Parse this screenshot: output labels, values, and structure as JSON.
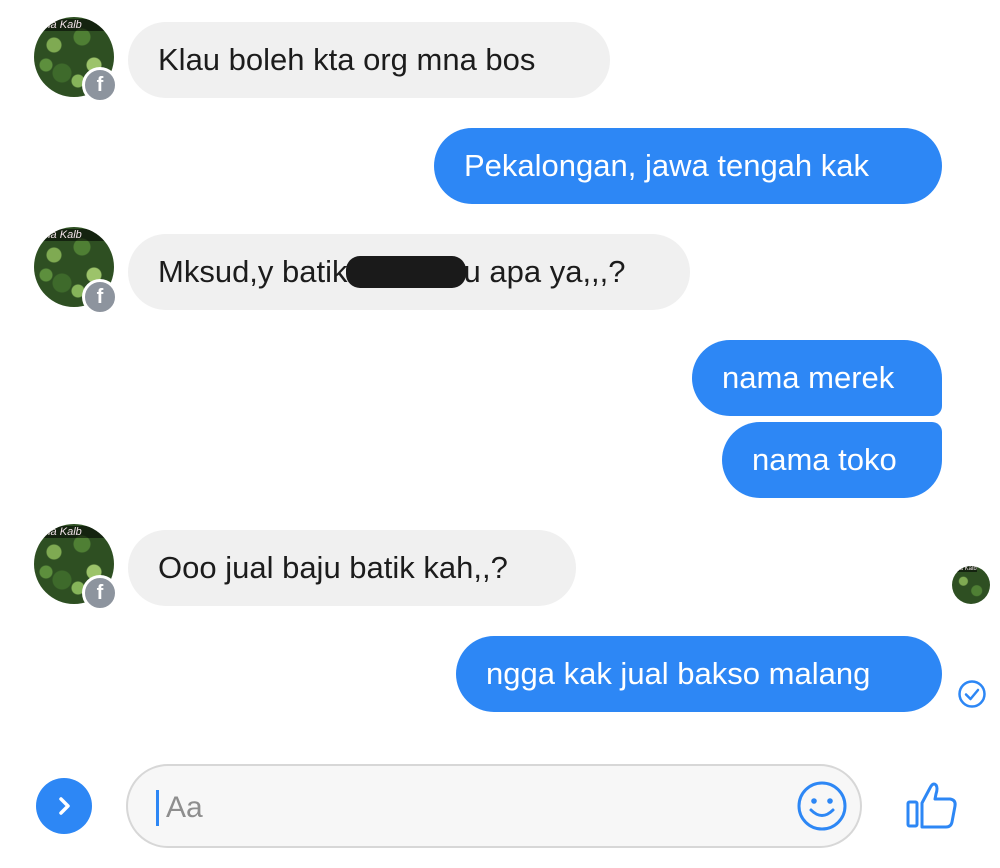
{
  "contact": {
    "avatar_caption": "dia Kalb",
    "badge_icon": "facebook-icon"
  },
  "messages": [
    {
      "id": "m1",
      "direction": "incoming",
      "text": "Klau boleh kta org mna bos"
    },
    {
      "id": "m2",
      "direction": "outgoing",
      "text": "Pekalongan, jawa tengah kak"
    },
    {
      "id": "m3",
      "direction": "incoming",
      "text_before": "Mksud,y batik",
      "text_after": "u apa ya,,,?",
      "redacted": true
    },
    {
      "id": "m4",
      "direction": "outgoing",
      "text": "nama merek"
    },
    {
      "id": "m5",
      "direction": "outgoing",
      "text": "nama toko"
    },
    {
      "id": "m6",
      "direction": "incoming",
      "text": "Ooo jual baju batik kah,,?"
    },
    {
      "id": "m7",
      "direction": "outgoing",
      "text": "ngga kak jual bakso malang"
    }
  ],
  "composer": {
    "placeholder": "Aa",
    "value": ""
  },
  "icons": {
    "expand": "chevron-right-icon",
    "emoji": "smiley-icon",
    "like": "thumbs-up-icon",
    "delivered": "check-circle-icon"
  },
  "colors": {
    "accent": "#2d87f5",
    "incoming_bubble": "#f0f0f0",
    "outgoing_text": "#ffffff"
  }
}
